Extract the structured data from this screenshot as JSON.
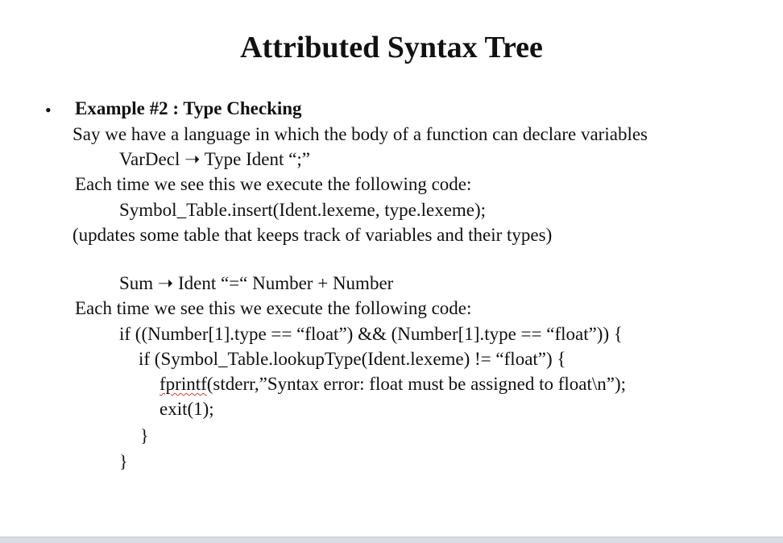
{
  "title": "Attributed Syntax Tree",
  "bullet_symbol": "•",
  "example_heading": "Example #2 : Type Checking",
  "lines": {
    "l1": "Say we have a language in which the body of a function can declare variables",
    "l2": "VarDecl ➝ Type Ident “;”",
    "l3": "Each time we see this we execute the following code:",
    "l4": "Symbol_Table.insert(Ident.lexeme, type.lexeme);",
    "l5": "(updates some table that keeps track of variables and their types)",
    "l6": "Sum ➝ Ident “=“ Number + Number",
    "l7": "Each time we see this we execute the following code:",
    "l8": "if ((Number[1].type == “float”) && (Number[1].type == “float”)) {",
    "l9": "if (Symbol_Table.lookupType(Ident.lexeme) != “float”) {",
    "l10_func": "fprintf",
    "l10_rest": "(stderr,”Syntax error: float must be assigned to float\\n”);",
    "l11": "exit(1);",
    "l12": "}",
    "l13": "}"
  }
}
